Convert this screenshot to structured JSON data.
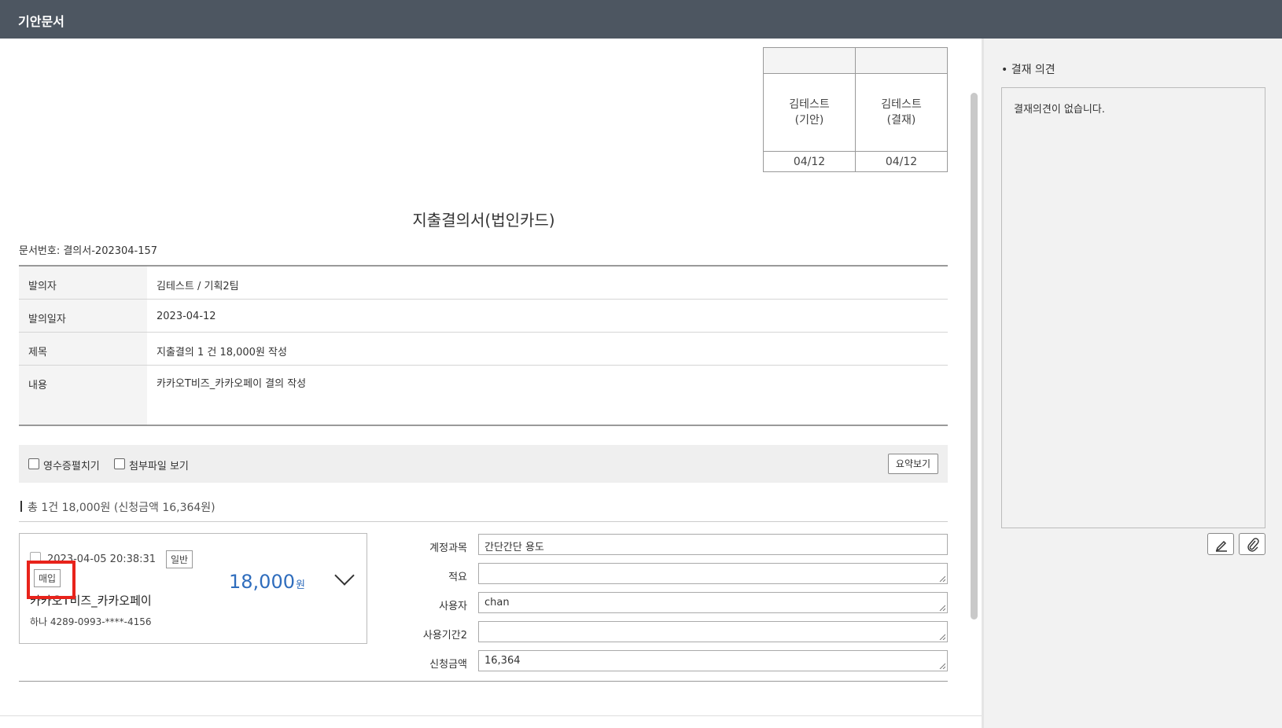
{
  "header": {
    "title": "기안문서"
  },
  "approval": {
    "columns": [
      {
        "name_line1": "김테스트",
        "name_line2": "(기안)",
        "date": "04/12"
      },
      {
        "name_line1": "김테스트",
        "name_line2": "(결재)",
        "date": "04/12"
      }
    ]
  },
  "document": {
    "title": "지출결의서(법인카드)",
    "doc_no": "문서번호: 결의서-202304-157",
    "rows": [
      {
        "label": "발의자",
        "value": "김테스트 / 기획2팀"
      },
      {
        "label": "발의일자",
        "value": "2023-04-12"
      },
      {
        "label": "제목",
        "value": "지출결의 1 건 18,000원 작성"
      },
      {
        "label": "내용",
        "value": "카카오T비즈_카카오페이 결의 작성"
      }
    ]
  },
  "toolbar": {
    "receipt_label": "영수증펼치기",
    "attachment_label": "첨부파일 보기",
    "summary_button": "요약보기"
  },
  "summary": {
    "total_text": "총 1건 18,000원 (신청금액 16,364원)"
  },
  "card": {
    "datetime": "2023-04-05 20:38:31",
    "type_tag": "일반",
    "purchase_tag": "매입",
    "amount": "18,000",
    "amount_unit": "원",
    "merchant": "카카오T비즈_카카오페이",
    "card_number": "하나 4289-0993-****-4156"
  },
  "fields": [
    {
      "label": "계정과목",
      "value": "간단간단 용도",
      "resizable": false
    },
    {
      "label": "적요",
      "value": "",
      "resizable": true
    },
    {
      "label": "사용자",
      "value": "chan",
      "resizable": true
    },
    {
      "label": "사용기간2",
      "value": "",
      "resizable": true
    },
    {
      "label": "신청금액",
      "value": "16,364",
      "resizable": true
    }
  ],
  "opinion": {
    "heading": "• 결재 의견",
    "empty_text": "결재의견이 없습니다."
  },
  "icons": {
    "edit": "pencil-icon",
    "attach": "paperclip-icon"
  },
  "colors": {
    "header_bg": "#4d5661",
    "amount": "#2f6dbd",
    "highlight": "#e8231b"
  }
}
